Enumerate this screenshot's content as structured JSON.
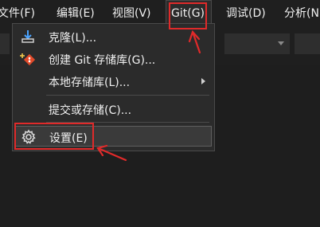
{
  "menubar": {
    "items": [
      {
        "label": "文件(F)"
      },
      {
        "label": "编辑(E)"
      },
      {
        "label": "视图(V)"
      },
      {
        "label": "Git(G)"
      },
      {
        "label": "调试(D)"
      },
      {
        "label": "分析(N"
      }
    ]
  },
  "git_menu": {
    "items": [
      {
        "label": "克隆(L)...",
        "icon": "clone-download-icon"
      },
      {
        "label": "创建 Git 存储库(G)...",
        "icon": "git-create-icon"
      },
      {
        "label": "本地存储库(L)...",
        "icon": "",
        "has_submenu": true
      },
      {
        "label": "提交或存储(C)...",
        "icon": ""
      },
      {
        "label": "设置(E)",
        "icon": "gear-icon"
      }
    ]
  },
  "colors": {
    "background": "#1e1e1e",
    "menu_background": "#2b2b2b",
    "annotation_red": "#e02a2a",
    "clone_icon_blue": "#4aa3ff",
    "git_icon_red": "#e24a2a"
  }
}
